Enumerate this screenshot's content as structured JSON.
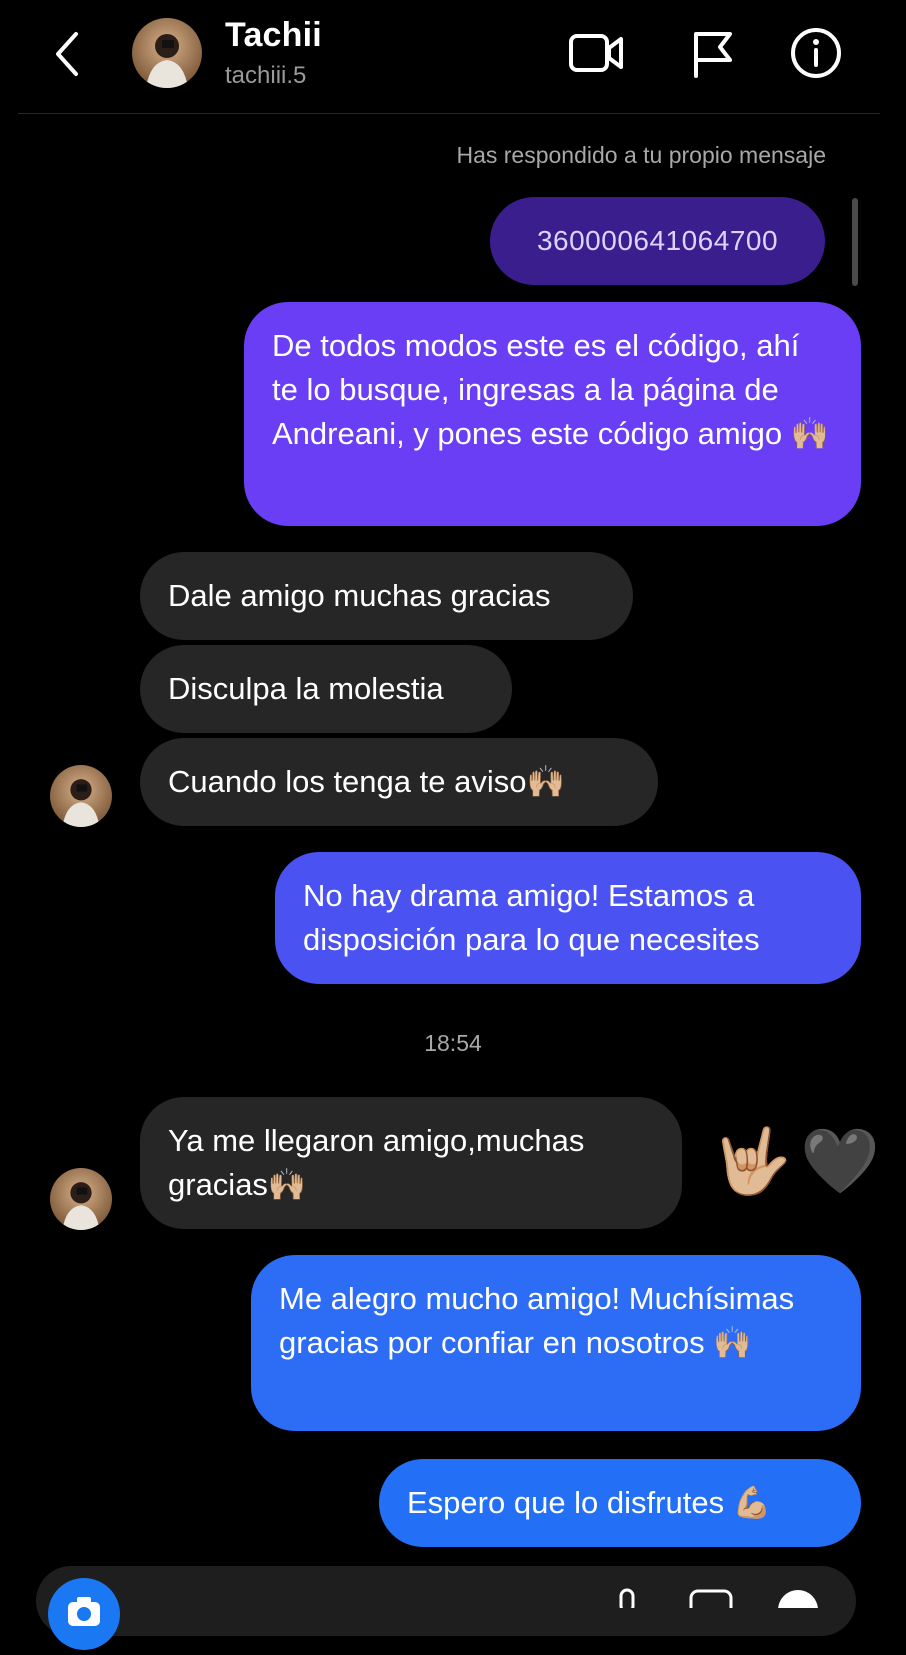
{
  "header": {
    "contact_name": "Tachii",
    "contact_username": "tachiii.5",
    "icons": [
      "back-chevron-icon",
      "video-call-icon",
      "flag-icon",
      "info-icon"
    ]
  },
  "thread": {
    "reply_note": "Has respondido a tu propio mensaje",
    "replied_message": "360000641064700",
    "messages": [
      {
        "from": "me",
        "text": "De todos modos este es el código, ahí te lo busque, ingresas a la página de Andreani, y pones este código amigo 🙌🏼"
      },
      {
        "from": "them",
        "text": "Dale amigo muchas gracias"
      },
      {
        "from": "them",
        "text": "Disculpa la molestia"
      },
      {
        "from": "them",
        "text": "Cuando los tenga te aviso🙌🏼"
      },
      {
        "from": "me",
        "text": "No hay drama amigo! Estamos a disposición para lo que necesites"
      },
      {
        "from": "them",
        "text": "Ya me llegaron amigo,muchas gracias🙌🏼"
      },
      {
        "from": "me",
        "text": "Me alegro mucho amigo! Muchísimas gracias por confiar en nosotros 🙌🏼"
      },
      {
        "from": "me",
        "text": "Espero que lo disfrutes 💪🏼"
      }
    ],
    "timestamp": "18:54",
    "reactions": [
      "🤟🏼",
      "🖤"
    ]
  },
  "colors": {
    "background": "#000000",
    "incoming_bubble": "#262626",
    "outgoing_purple": "#6a3ef5",
    "outgoing_indigo": "#4a52f2",
    "outgoing_blue": "#2d6df5",
    "reply_bubble": "#3a1e8e",
    "camera_button": "#1a78f2"
  }
}
